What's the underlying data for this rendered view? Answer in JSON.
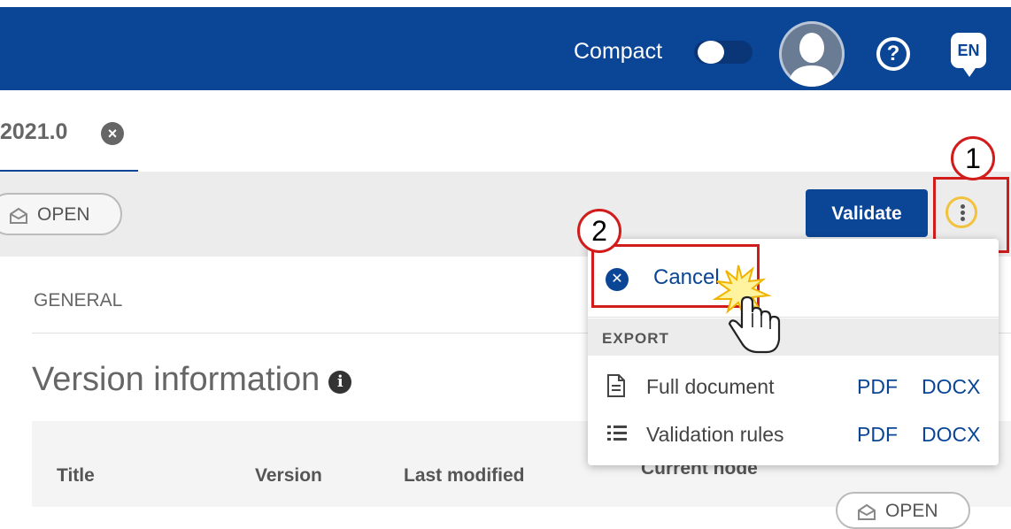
{
  "header": {
    "compact_label": "Compact",
    "compact_on": false,
    "language": "EN",
    "brand_color": "#0a4596"
  },
  "tab": {
    "label": "2021.0",
    "close_icon": "close-circle-icon"
  },
  "toolbar": {
    "status_label": "OPEN",
    "validate_label": "Validate",
    "more_icon": "kebab-vertical-icon"
  },
  "annotations": {
    "first": "1",
    "second": "2"
  },
  "content": {
    "section_label": "GENERAL",
    "heading": "Version information",
    "info_icon": "info-circle-icon",
    "columns": [
      "Title",
      "Version",
      "Last modified",
      "Current node"
    ],
    "row_status": "OPEN"
  },
  "menu": {
    "cancel_label": "Cancel",
    "export_section": "EXPORT",
    "exports": [
      {
        "label": "Full document",
        "pdf": "PDF",
        "docx": "DOCX",
        "icon": "document-icon"
      },
      {
        "label": "Validation rules",
        "pdf": "PDF",
        "docx": "DOCX",
        "icon": "list-icon"
      }
    ]
  }
}
